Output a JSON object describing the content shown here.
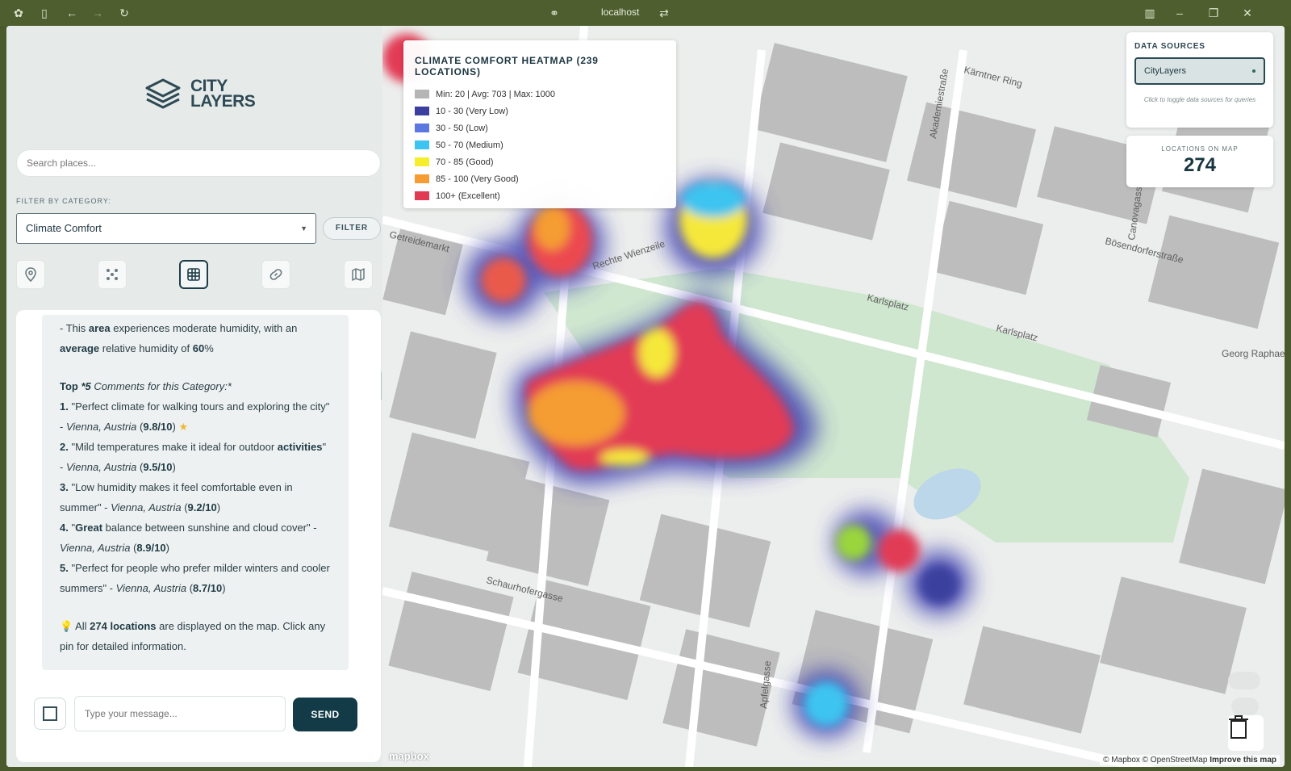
{
  "browser": {
    "url": "localhost"
  },
  "sidebar": {
    "search_placeholder": "Search places...",
    "filter_label": "FILTER BY CATEGORY:",
    "category_selected": "Climate Comfort",
    "filter_button": "FILTER",
    "logo_line1": "CITY",
    "logo_line2": "LAYERS"
  },
  "chat": {
    "input_placeholder": "Type your message...",
    "send_label": "SEND",
    "comments_heading": "Top *5 Comments for this Category:*",
    "comments": [
      {
        "num": "1.",
        "quote": "\"Perfect climate for walking tours and exploring the city\"",
        "place": "Vienna, Austria",
        "score": "9.8/10"
      },
      {
        "num": "2.",
        "quote": "\"Mild temperatures make it ideal for outdoor activities\"",
        "place": "Vienna, Austria",
        "score": "9.5/10"
      },
      {
        "num": "3.",
        "quote": "\"Low humidity makes it feel comfortable even in summer\"",
        "place": "Vienna, Austria",
        "score": "9.2/10"
      },
      {
        "num": "4.",
        "quote": "\"Great balance between sunshine and cloud cover\"",
        "place": "Vienna, Austria",
        "score": "8.9/10"
      },
      {
        "num": "5.",
        "quote": "\"Perfect for people who prefer milder winters and cooler summers\"",
        "place": "Vienna, Austria",
        "score": "8.7/10"
      }
    ],
    "footer_count": "274 locations"
  },
  "legend": {
    "title": "CLIMATE COMFORT HEATMAP (239 LOCATIONS)",
    "items": [
      {
        "label": "Min: 20 | Avg: 703 | Max: 1000",
        "color": "#b5b5b5"
      },
      {
        "label": "10 - 30 (Very Low)",
        "color": "#3b3f9e"
      },
      {
        "label": "30 - 50 (Low)",
        "color": "#5b78e0"
      },
      {
        "label": "50 - 70 (Medium)",
        "color": "#3ec4f0"
      },
      {
        "label": "70 - 85 (Good)",
        "color": "#f6ee2c"
      },
      {
        "label": "85 - 100 (Very Good)",
        "color": "#f59c32"
      },
      {
        "label": "100+ (Excellent)",
        "color": "#e23a55"
      }
    ]
  },
  "data_sources": {
    "title": "DATA SOURCES",
    "selected": "CityLayers",
    "hint": "Click to toggle data sources for queries"
  },
  "locations": {
    "label": "LOCATIONS ON MAP",
    "value": "274"
  },
  "map_labels": {
    "streets": [
      "Getreidemarkt",
      "Rechte Wienzeile",
      "Karlsplatz",
      "Karlsplatz",
      "Kärntner Ring",
      "Bösendorferstraße",
      "Akademiestraße",
      "Schaurhofergasse",
      "Apfelgasse",
      "Canovagasse",
      "Georg Raphael"
    ],
    "attribution": "© Mapbox © OpenStreetMap",
    "improve": "Improve this map",
    "mapbox": "mapbox"
  }
}
